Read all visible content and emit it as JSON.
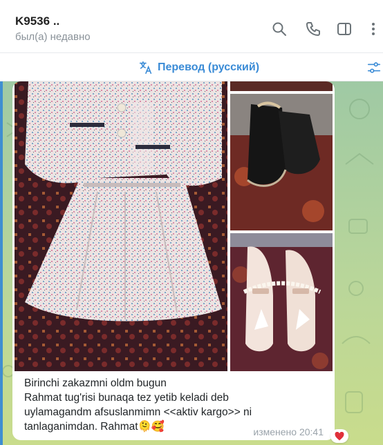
{
  "header": {
    "title": "K9536 ..",
    "status": "был(а) недавно",
    "icons": [
      "search-icon",
      "phone-icon",
      "sidebar-icon",
      "more-vertical-icon"
    ]
  },
  "translate_bar": {
    "label": "Перевод (русский)",
    "icons": [
      "translate-icon",
      "filter-icon"
    ]
  },
  "message": {
    "caption_lines": [
      "Birinchi zakazmni oldm bugun",
      "Rahmat tug'risi bunaqa tez yetib keladi deb",
      "uylamagandm afsuslanmimn <<aktiv kargo>> ni",
      "tanlaganimdan. Rahmat🫠🥰"
    ],
    "edited_time": "изменено 20:41",
    "reaction": "❤️",
    "photos": [
      "girls-tweed-jacket-skirt-set-photo",
      "black-ankle-boots-photo",
      "white-pearl-mary-jane-shoes-photo"
    ]
  },
  "colors": {
    "accent": "#3a8bd6",
    "wallpaper": "#b9d69a"
  }
}
